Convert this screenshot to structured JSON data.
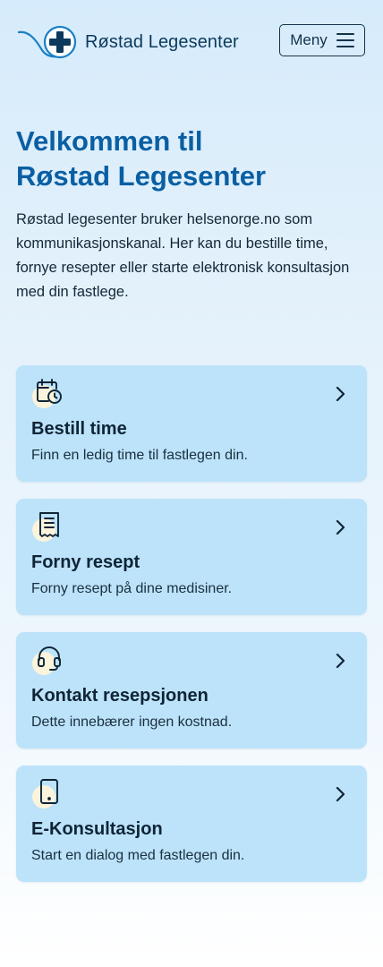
{
  "header": {
    "logo_text": "Røstad Legesenter",
    "menu_label": "Meny"
  },
  "hero": {
    "title_line1": "Velkommen til",
    "title_line2": "Røstad Legesenter",
    "description": "Røstad legesenter bruker helsenorge.no som kommunikasjonskanal. Her kan du bestille time, fornye resepter eller starte elektronisk konsultasjon med din fastlege."
  },
  "cards": [
    {
      "title": "Bestill time",
      "subtitle": "Finn en ledig time til fastlegen din.",
      "icon": "calendar-clock-icon"
    },
    {
      "title": "Forny resept",
      "subtitle": "Forny resept på dine medisiner.",
      "icon": "prescription-document-icon"
    },
    {
      "title": "Kontakt resepsjonen",
      "subtitle": "Dette innebærer ingen kostnad.",
      "icon": "headset-icon"
    },
    {
      "title": "E-Konsultasjon",
      "subtitle": "Start en dialog med fastlegen din.",
      "icon": "tablet-icon"
    }
  ],
  "colors": {
    "accent": "#0a5fa3",
    "card_background": "#bce3f9",
    "icon_blob": "#fbf3dc",
    "text_dark": "#0f2436"
  }
}
